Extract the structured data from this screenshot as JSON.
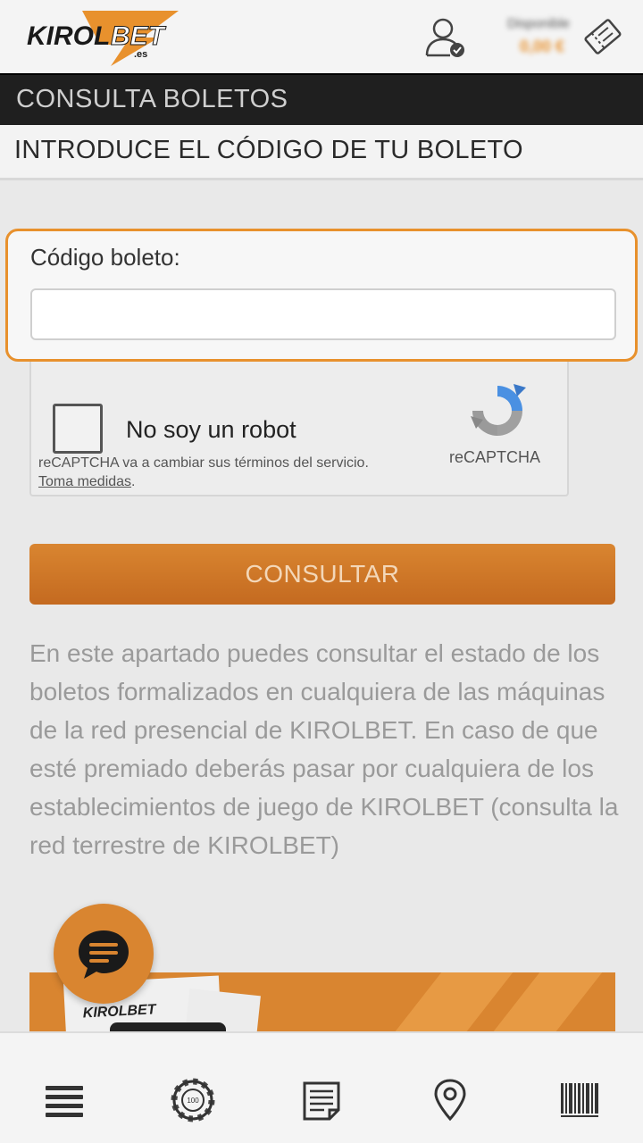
{
  "header": {
    "logo_text": "KIROLBET",
    "logo_suffix": ".es",
    "balance_label": "Disponible",
    "balance_amount": "0,00 €",
    "user_icon": "user-verified-icon",
    "ticket_icon": "ticket-icon"
  },
  "section_title": "CONSULTA BOLETOS",
  "subtitle": "INTRODUCE EL CÓDIGO DE TU BOLETO",
  "form": {
    "code_label": "Código boleto:",
    "code_value": "",
    "code_placeholder": ""
  },
  "captcha": {
    "label": "No soy un robot",
    "terms_text": "reCAPTCHA va a cambiar sus términos del servicio.",
    "terms_link": "Toma medidas",
    "brand": "reCAPTCHA"
  },
  "consult_button": "CONSULTAR",
  "description": "En este apartado puedes consultar el estado de los boletos formalizados en cualquiera de las máquinas de la red presencial de KIROLBET. En caso de que esté premiado deberás pasar por cualquiera de los establecimientos de juego de KIROLBET (consulta la red terrestre de KIROLBET)",
  "banner": {
    "card_logo": "KIROLBET"
  },
  "bottom_nav": [
    {
      "icon": "menu-icon"
    },
    {
      "icon": "casino-chip-icon",
      "text": "100"
    },
    {
      "icon": "betslip-icon"
    },
    {
      "icon": "location-pin-icon"
    },
    {
      "icon": "barcode-icon"
    }
  ],
  "colors": {
    "accent": "#e8912d",
    "dark_bar": "#1f1f1f",
    "button": "#d98530"
  }
}
